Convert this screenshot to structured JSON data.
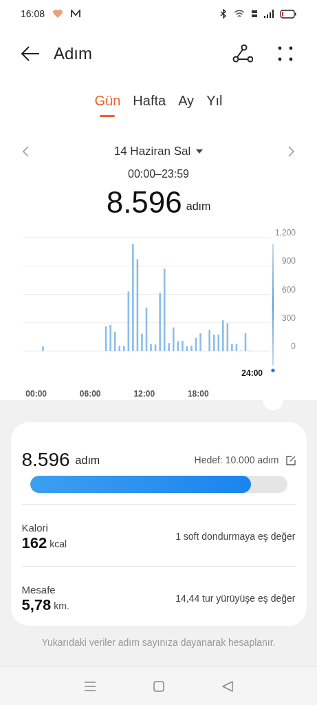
{
  "status_bar": {
    "time": "16:08"
  },
  "header": {
    "title": "Adım"
  },
  "tabs": [
    {
      "label": "Gün",
      "selected": true
    },
    {
      "label": "Hafta",
      "selected": false
    },
    {
      "label": "Ay",
      "selected": false
    },
    {
      "label": "Yıl",
      "selected": false
    }
  ],
  "date": {
    "label": "14 Haziran Sal",
    "range": "00:00–23:59",
    "total": "8.596",
    "unit": "adım"
  },
  "chart": {
    "cursor_label": "24:00",
    "chart_data": {
      "type": "bar",
      "grid": true,
      "x": [
        0.25,
        0.75,
        1.25,
        1.75,
        2.25,
        2.75,
        3.25,
        3.75,
        4.25,
        4.75,
        5.25,
        5.75,
        6.25,
        6.75,
        7.25,
        7.75,
        8.25,
        8.75,
        9.25,
        9.75,
        10.25,
        10.75,
        11.25,
        11.75,
        12.25,
        12.75,
        13.25,
        13.75,
        14.25,
        14.75,
        15.25,
        15.75,
        16.25,
        16.75,
        17.25,
        17.75,
        18.25,
        18.75,
        19.25,
        19.75,
        20.25,
        20.75,
        21.25,
        21.75,
        22.25,
        22.75,
        23.25,
        23.75
      ],
      "series": [
        {
          "color": "#8bbde9",
          "values": [
            0,
            50,
            0,
            0,
            0,
            0,
            0,
            0,
            0,
            0,
            0,
            0,
            0,
            0,
            0,
            260,
            275,
            205,
            55,
            55,
            630,
            1130,
            970,
            185,
            460,
            75,
            70,
            615,
            870,
            85,
            250,
            105,
            110,
            50,
            60,
            140,
            190,
            0,
            225,
            175,
            175,
            325,
            295,
            75,
            75,
            5,
            190,
            5
          ]
        }
      ],
      "xlim": [
        -1.5,
        26
      ],
      "ylim": [
        0,
        1200
      ],
      "yticks": [
        {
          "value": 0,
          "label": "0"
        },
        {
          "value": 300,
          "label": "300"
        },
        {
          "value": 600,
          "label": "600"
        },
        {
          "value": 900,
          "label": "900"
        },
        {
          "value": 1200,
          "label": "1.200"
        }
      ],
      "xticks": [
        {
          "value": 0,
          "label": "00:00"
        },
        {
          "value": 6,
          "label": "06:00"
        },
        {
          "value": 12,
          "label": "12:00"
        },
        {
          "value": 18,
          "label": "18:00"
        }
      ]
    }
  },
  "summary": {
    "steps": "8.596",
    "unit": "adım",
    "goal": "Hedef: 10.000 adım",
    "level": 0.86,
    "metrics": [
      {
        "label": "Kalori",
        "value": "162",
        "unit": "kcal",
        "comparison": "1 soft dondurmaya eş değer"
      },
      {
        "label": "Mesafe",
        "value": "5,78",
        "unit": "km.",
        "comparison": "14,44 tur yürüyüşe eş değer"
      }
    ]
  },
  "footnote": "Yukarıdaki veriler adım sayınıza dayanarak hesaplanır."
}
